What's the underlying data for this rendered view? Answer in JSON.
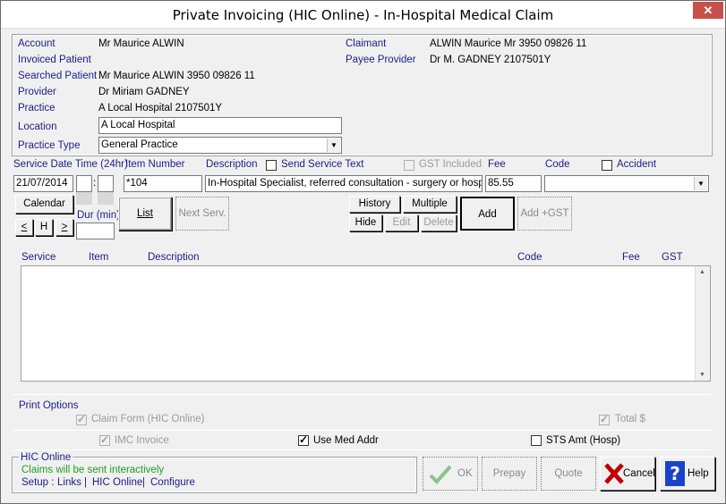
{
  "window": {
    "title": "Private Invoicing (HIC Online) - In-Hospital Medical Claim",
    "close": "✕"
  },
  "patient": {
    "account_label": "Account",
    "account": "Mr Maurice ALWIN",
    "invoiced_label": "Invoiced Patient",
    "invoiced": "",
    "searched_label": "Searched Patient",
    "searched": "Mr Maurice ALWIN 3950 09826 11",
    "provider_label": "Provider",
    "provider": "Dr Miriam GADNEY",
    "practice_label": "Practice",
    "practice": "A Local Hospital 2107501Y",
    "location_label": "Location",
    "location": "A Local Hospital",
    "practice_type_label": "Practice Type",
    "practice_type": "General Practice",
    "claimant_label": "Claimant",
    "claimant": "ALWIN Maurice Mr 3950 09826 11",
    "payee_label": "Payee Provider",
    "payee": "Dr M. GADNEY 2107501Y"
  },
  "service": {
    "date_label": "Service Date Time (24hr)",
    "date": "21/07/2014",
    "item_label": "Item Number",
    "item": "*104",
    "desc_label": "Description",
    "send_text_label": "Send Service Text",
    "gst_label": "GST Included",
    "fee_label": "Fee",
    "fee": "85.55",
    "code_label": "Code",
    "accident_label": "Accident",
    "description": "In-Hospital Specialist, referred consultation - surgery or  hospital (p",
    "dur_label": "Dur (min)",
    "time_sep": ":"
  },
  "buttons": {
    "calendar": "Calendar",
    "prev": "<",
    "h": "H",
    "next": ">",
    "list": "List",
    "next_serv": "Next Serv.",
    "history": "History",
    "multiple": "Multiple",
    "hide": "Hide",
    "edit": "Edit",
    "delete": "Delete",
    "add": "Add",
    "add_gst": "Add +GST",
    "ok": "OK",
    "prepay": "Prepay",
    "quote": "Quote",
    "cancel": "Cancel",
    "help": "Help"
  },
  "table": {
    "columns": [
      "Service",
      "Item",
      "Description",
      "Code",
      "Fee",
      "GST"
    ],
    "rows": []
  },
  "print_options": {
    "title": "Print Options",
    "claim_form": "Claim Form  (HIC Online)",
    "total": "Total $",
    "imc_invoice": "IMC Invoice",
    "use_med_addr": "Use Med Addr",
    "sts_amt": "STS Amt (Hosp)"
  },
  "hic": {
    "title": "HIC Online",
    "status": "Claims will be sent interactively",
    "setup": "Setup :",
    "links": "Links",
    "sep": "|",
    "hic_online": "HIC Online",
    "configure": "Configure"
  },
  "colors": {
    "label": "#1c1c8a",
    "status": "#1f9e1f",
    "close": "#c7504a"
  }
}
